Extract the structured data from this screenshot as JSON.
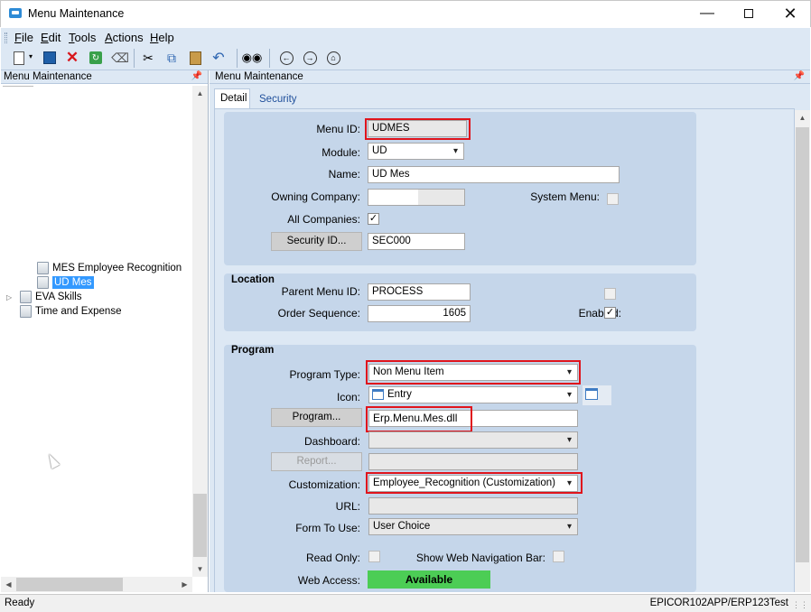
{
  "window": {
    "title": "Menu Maintenance"
  },
  "menu": [
    "File",
    "Edit",
    "Tools",
    "Actions",
    "Help"
  ],
  "left_panel": {
    "title": "Menu Maintenance",
    "tree": [
      {
        "label": "MES Employee Recognition"
      },
      {
        "label": "UD Mes",
        "selected": true
      },
      {
        "label": "EVA Skills"
      },
      {
        "label": "Time and Expense"
      }
    ]
  },
  "main": {
    "title": "Menu Maintenance",
    "tabs": [
      "Detail",
      "Security"
    ],
    "menu_id_label": "Menu ID:",
    "menu_id": "UDMES",
    "module_label": "Module:",
    "module": "UD",
    "name_label": "Name:",
    "name": "UD Mes",
    "owning_company_label": "Owning Company:",
    "owning_company": "",
    "system_menu_label": "System Menu:",
    "all_companies_label": "All Companies:",
    "all_companies": true,
    "security_id_button": "Security ID...",
    "security_id": "SEC000",
    "location": {
      "title": "Location",
      "parent_menu_id_label": "Parent Menu ID:",
      "parent_menu_id": "PROCESS",
      "order_sequence_label": "Order Sequence:",
      "order_sequence": "1605",
      "enabled_label": "Enabled:",
      "enabled": true
    },
    "program": {
      "title": "Program",
      "program_type_label": "Program Type:",
      "program_type": "Non Menu Item",
      "icon_label": "Icon:",
      "icon": "Entry",
      "program_button": "Program...",
      "program": "Erp.Menu.Mes.dll",
      "dashboard_label": "Dashboard:",
      "dashboard": "",
      "report_button": "Report...",
      "report": "",
      "customization_label": "Customization:",
      "customization": "Employee_Recognition (Customization)",
      "url_label": "URL:",
      "url": "",
      "form_to_use_label": "Form To Use:",
      "form_to_use": "User Choice",
      "read_only_label": "Read Only:",
      "show_web_nav_label": "Show Web Navigation Bar:",
      "web_access_label": "Web Access:",
      "web_access": "Available"
    }
  },
  "status": {
    "left": "Ready",
    "right": "EPICOR102APP/ERP123Test"
  },
  "colors": {
    "accent": "#dde8f4",
    "group": "#c5d6ea",
    "highlight": "#e0141c",
    "available": "#4ccd55",
    "selection": "#3399ff"
  }
}
